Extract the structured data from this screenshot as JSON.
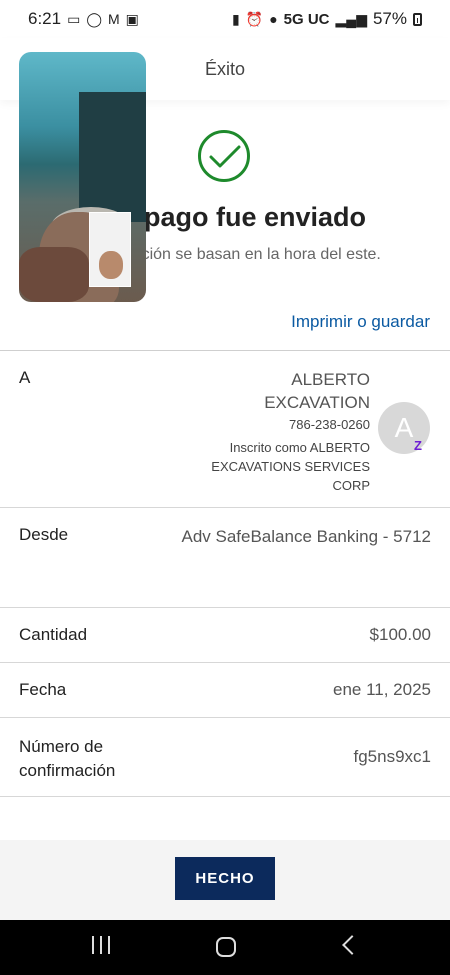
{
  "status_bar": {
    "time": "6:21",
    "network": "5G UC",
    "battery": "57%"
  },
  "header": {
    "title": "Éxito"
  },
  "confirmation": {
    "title": "pago fue enviado",
    "subtitle": "transacción se basan en la hora del este.",
    "print_label": "Imprimir o guardar"
  },
  "recipient": {
    "label": "A",
    "name": "ALBERTO EXCAVATION",
    "phone": "786-238-0260",
    "enrolled": "Inscrito como ALBERTO EXCAVATIONS SERVICES CORP",
    "avatar_initial": "A",
    "badge": "Z"
  },
  "details": {
    "from_label": "Desde",
    "from_value": "Adv SafeBalance Banking - 5712",
    "amount_label": "Cantidad",
    "amount_value": "$100.00",
    "date_label": "Fecha",
    "date_value": "ene 11, 2025",
    "confirmation_label": "Número de confirmación",
    "confirmation_value": "fg5ns9xc1"
  },
  "footer": {
    "done_label": "HECHO"
  },
  "colors": {
    "success_green": "#1e8a2c",
    "link_blue": "#0b5aa2",
    "button_navy": "#0c2a5c",
    "zelle_purple": "#6d1ed4"
  },
  "icons": [
    "video-icon",
    "whatsapp-icon",
    "gmail-icon",
    "gallery-icon",
    "battery-saver-icon",
    "alarm-icon",
    "location-icon",
    "signal-icon",
    "battery-icon",
    "success-check-icon",
    "recent-apps-icon",
    "home-icon",
    "back-icon"
  ]
}
